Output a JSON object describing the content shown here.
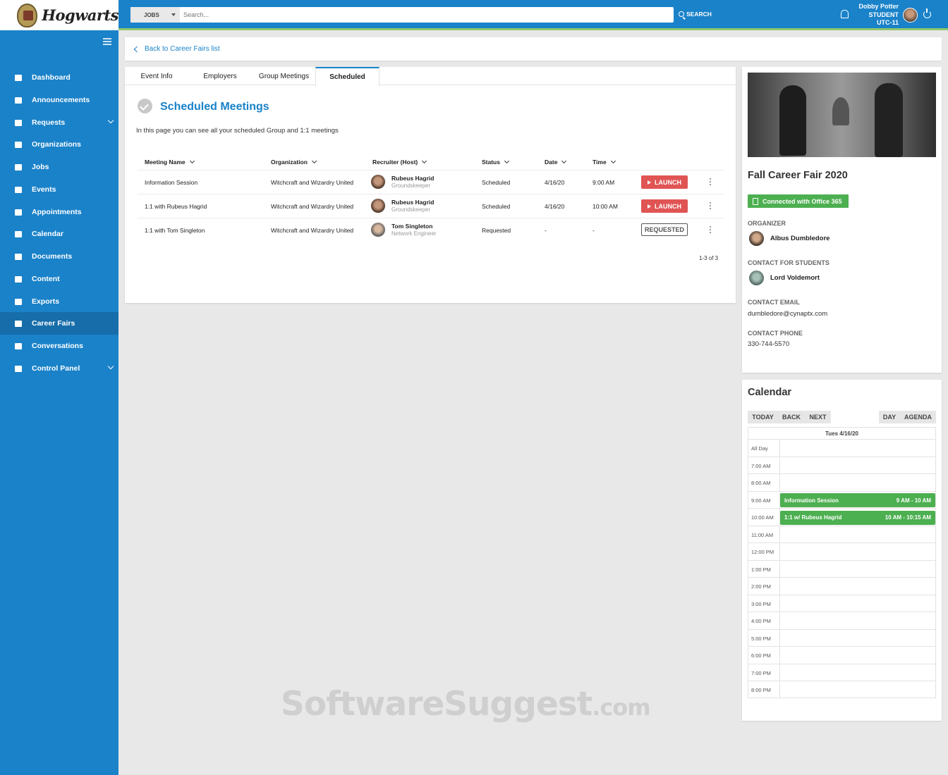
{
  "brand": {
    "name": "Hogwarts"
  },
  "sidebar": {
    "items": [
      {
        "label": "Dashboard",
        "icon": "home-icon"
      },
      {
        "label": "Announcements",
        "icon": "megaphone-icon"
      },
      {
        "label": "Requests",
        "icon": "calendar-check-icon",
        "expandable": true
      },
      {
        "label": "Organizations",
        "icon": "sitemap-icon"
      },
      {
        "label": "Jobs",
        "icon": "briefcase-icon"
      },
      {
        "label": "Events",
        "icon": "ticket-icon"
      },
      {
        "label": "Appointments",
        "icon": "user-calendar-icon"
      },
      {
        "label": "Calendar",
        "icon": "calendar-icon"
      },
      {
        "label": "Documents",
        "icon": "document-icon"
      },
      {
        "label": "Content",
        "icon": "book-icon"
      },
      {
        "label": "Exports",
        "icon": "export-icon"
      },
      {
        "label": "Career Fairs",
        "icon": "handshake-icon",
        "active": true
      },
      {
        "label": "Conversations",
        "icon": "chat-icon"
      },
      {
        "label": "Control Panel",
        "icon": "gear-icon",
        "expandable": true
      }
    ]
  },
  "topbar": {
    "search_category": "JOBS",
    "search_placeholder": "Search...",
    "search_label": "SEARCH",
    "user_name": "Dobby Potter",
    "user_role": "STUDENT",
    "user_tz": "UTC-11"
  },
  "back_link": "Back to Career Fairs list",
  "tabs": [
    {
      "label": "Event Info"
    },
    {
      "label": "Employers"
    },
    {
      "label": "Group Meetings"
    },
    {
      "label": "Scheduled",
      "selected": true
    }
  ],
  "scheduled": {
    "title": "Scheduled Meetings",
    "description": "In this page you can see all your scheduled Group and 1:1 meetings",
    "columns": [
      "Meeting Name",
      "Organization",
      "Recruiter (Host)",
      "Status",
      "Date",
      "Time"
    ],
    "rows": [
      {
        "name": "Information Session",
        "org": "Witchcraft and Wizardry United",
        "recruiter": "Rubeus Hagrid",
        "recruiter_title": "Groundskeeper",
        "status": "Scheduled",
        "date": "4/16/20",
        "time": "9:00 AM",
        "action": "LAUNCH"
      },
      {
        "name": "1:1 with Rubeus Hagrid",
        "org": "Witchcraft and Wizardry United",
        "recruiter": "Rubeus Hagrid",
        "recruiter_title": "Groundskeeper",
        "status": "Scheduled",
        "date": "4/16/20",
        "time": "10:00 AM",
        "action": "LAUNCH"
      },
      {
        "name": "1:1 with Tom Singleton",
        "org": "Witchcraft and Wizardry United",
        "recruiter": "Tom Singleton",
        "recruiter_title": "Network Engineer",
        "status": "Requested",
        "date": "-",
        "time": "-",
        "action": "REQUESTED"
      }
    ],
    "pagination": "1-3 of 3"
  },
  "event": {
    "title": "Fall Career Fair 2020",
    "o365": "Connected with Office 365",
    "organizer_label": "ORGANIZER",
    "organizer": "Albus Dumbledore",
    "contact_label": "CONTACT FOR STUDENTS",
    "contact": "Lord Voldemort",
    "email_label": "CONTACT EMAIL",
    "email": "dumbledore@cynaptx.com",
    "phone_label": "CONTACT PHONE",
    "phone": "330-744-5570"
  },
  "calendar": {
    "title": "Calendar",
    "buttons": {
      "today": "TODAY",
      "back": "BACK",
      "next": "NEXT",
      "day": "DAY",
      "agenda": "AGENDA"
    },
    "day_header": "Tues 4/16/20",
    "slots": [
      "All Day",
      "7:00 AM",
      "8:00 AM",
      "9:00 AM",
      "10:00 AM",
      "11:00 AM",
      "12:00 PM",
      "1:00 PM",
      "2:00 PM",
      "3:00 PM",
      "4:00 PM",
      "5:00 PM",
      "6:00 PM",
      "7:00 PM",
      "8:00 PM"
    ],
    "events": [
      {
        "title": "Information Session",
        "range": "9 AM - 10 AM"
      },
      {
        "title": "1:1 w/ Rubeus Hagrid",
        "range": "10 AM - 10:15 AM"
      }
    ]
  },
  "watermark": {
    "main": "SoftwareSuggest",
    "suffix": ".com"
  },
  "colors": {
    "primary": "#1a82c9",
    "accent_green": "#4caf50",
    "launch_red": "#e05454"
  }
}
